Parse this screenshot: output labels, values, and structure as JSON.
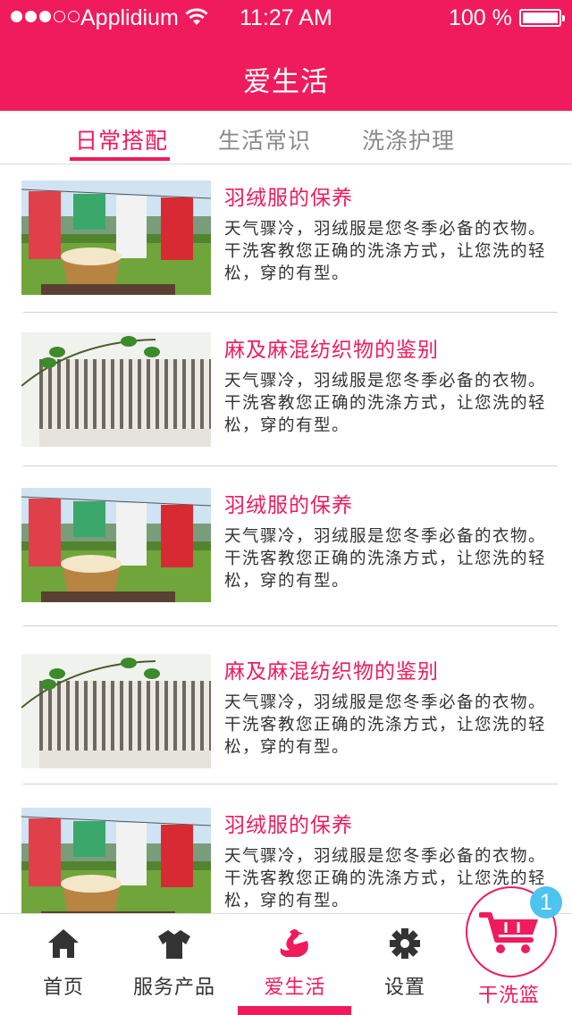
{
  "status_bar": {
    "carrier": "Applidium",
    "time": "11:27  AM",
    "battery": "100  %"
  },
  "header": {
    "title": "爱生活"
  },
  "tabs": [
    {
      "label": "日常搭配",
      "active": true
    },
    {
      "label": "生活常识",
      "active": false
    },
    {
      "label": "洗涤护理",
      "active": false
    }
  ],
  "articles": [
    {
      "title": "羽绒服的保养",
      "desc": "天气骤冷，羽绒服是您冬季必备的衣物。干洗客教您正确的洗涤方式，让您洗的轻松，穿的有型。",
      "image": "laundry-basket-clothesline"
    },
    {
      "title": "麻及麻混纺织物的鉴别",
      "desc": "天气骤冷，羽绒服是您冬季必备的衣物。干洗客教您正确的洗涤方式，让您洗的轻松，穿的有型。",
      "image": "striped-linen-fabric"
    },
    {
      "title": "羽绒服的保养",
      "desc": "天气骤冷，羽绒服是您冬季必备的衣物。干洗客教您正确的洗涤方式，让您洗的轻松，穿的有型。",
      "image": "laundry-basket-clothesline"
    },
    {
      "title": "麻及麻混纺织物的鉴别",
      "desc": "天气骤冷，羽绒服是您冬季必备的衣物。干洗客教您正确的洗涤方式，让您洗的轻松，穿的有型。",
      "image": "striped-linen-fabric"
    },
    {
      "title": "羽绒服的保养",
      "desc": "天气骤冷，羽绒服是您冬季必备的衣物。干洗客教您正确的洗涤方式，让您洗的轻松，穿的有型。",
      "image": "laundry-basket-clothesline"
    }
  ],
  "tabbar": {
    "home": {
      "label": "首页",
      "icon": "home-icon"
    },
    "services": {
      "label": "服务产品",
      "icon": "shirt-icon"
    },
    "life": {
      "label": "爱生活",
      "icon": "swan-icon",
      "active": true
    },
    "settings": {
      "label": "设置",
      "icon": "gear-icon"
    },
    "basket": {
      "label": "干洗篮",
      "icon": "cart-icon",
      "badge": "1"
    }
  },
  "colors": {
    "accent": "#f01b5c",
    "badge": "#4fc3f0"
  }
}
